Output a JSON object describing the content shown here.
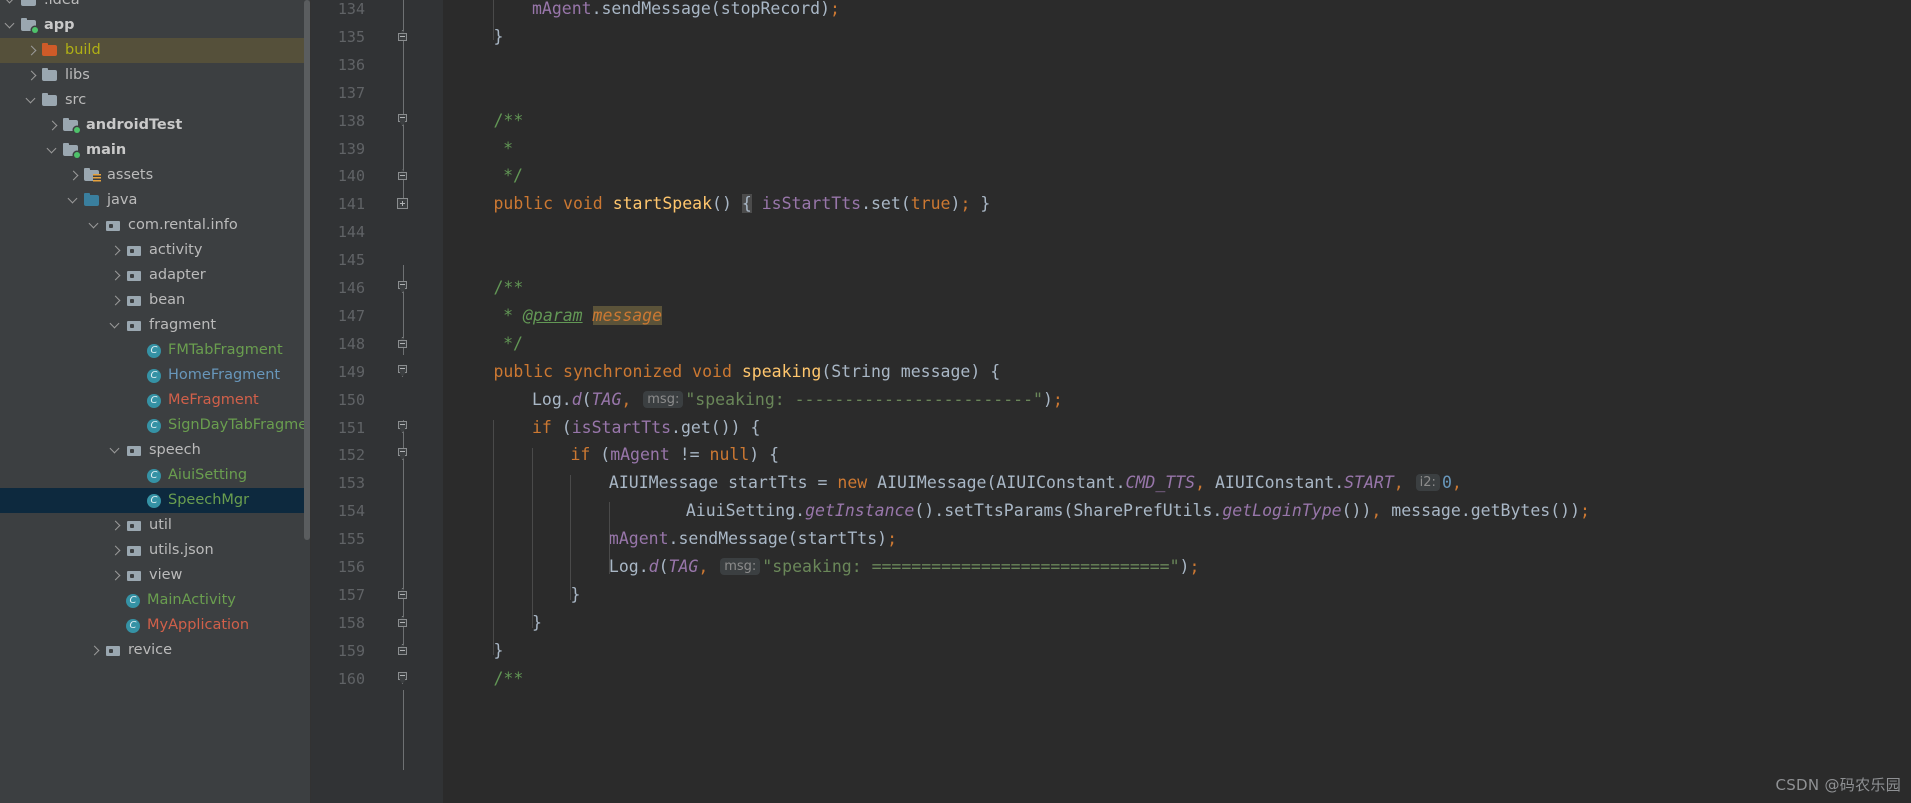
{
  "window": {
    "theme": "darcula",
    "colors": {
      "sidebar_bg": "#3c3f41",
      "editor_bg": "#2b2b2b",
      "gutter_bg": "#313335",
      "selection_bg": "#0d293e",
      "build_highlight_bg": "#55503a",
      "keyword": "#cc7832",
      "string": "#6a8759",
      "comment": "#629755",
      "number": "#6897bb",
      "field": "#9876aa",
      "method_decl": "#ffc66d",
      "default_text": "#a9b7c6",
      "line_number": "#606366"
    }
  },
  "project_tree": {
    "name": "Project",
    "items": [
      {
        "label": ".idea",
        "indent": 0,
        "twisty": "down",
        "icon": "folder-icon",
        "style": "plain",
        "selected": false
      },
      {
        "label": "app",
        "indent": 0,
        "twisty": "down",
        "icon": "module-folder-icon",
        "style": "bold",
        "selected": false
      },
      {
        "label": "build",
        "indent": 1,
        "twisty": "right",
        "icon": "folder-red-icon",
        "style": "build",
        "selected": false
      },
      {
        "label": "libs",
        "indent": 1,
        "twisty": "right",
        "icon": "folder-icon",
        "style": "plain",
        "selected": false
      },
      {
        "label": "src",
        "indent": 1,
        "twisty": "down",
        "icon": "folder-icon",
        "style": "plain",
        "selected": false
      },
      {
        "label": "androidTest",
        "indent": 2,
        "twisty": "right",
        "icon": "module-folder-icon",
        "style": "bold",
        "selected": false
      },
      {
        "label": "main",
        "indent": 2,
        "twisty": "down",
        "icon": "module-folder-icon",
        "style": "bold",
        "selected": false
      },
      {
        "label": "assets",
        "indent": 3,
        "twisty": "right",
        "icon": "assets-folder-icon",
        "style": "plain",
        "selected": false
      },
      {
        "label": "java",
        "indent": 3,
        "twisty": "down",
        "icon": "folder-blue-icon",
        "style": "plain",
        "selected": false
      },
      {
        "label": "com.rental.info",
        "indent": 4,
        "twisty": "down",
        "icon": "package-icon",
        "style": "plain",
        "selected": false
      },
      {
        "label": "activity",
        "indent": 5,
        "twisty": "right",
        "icon": "package-icon",
        "style": "plain",
        "selected": false
      },
      {
        "label": "adapter",
        "indent": 5,
        "twisty": "right",
        "icon": "package-icon",
        "style": "plain",
        "selected": false
      },
      {
        "label": "bean",
        "indent": 5,
        "twisty": "right",
        "icon": "package-icon",
        "style": "plain",
        "selected": false
      },
      {
        "label": "fragment",
        "indent": 5,
        "twisty": "down",
        "icon": "package-icon",
        "style": "plain",
        "selected": false
      },
      {
        "label": "FMTabFragment",
        "indent": 6,
        "twisty": "none",
        "icon": "java-class-icon",
        "style": "green",
        "selected": false
      },
      {
        "label": "HomeFragment",
        "indent": 6,
        "twisty": "none",
        "icon": "java-class-icon",
        "style": "blue",
        "selected": false
      },
      {
        "label": "MeFragment",
        "indent": 6,
        "twisty": "none",
        "icon": "java-class-icon",
        "style": "red",
        "selected": false
      },
      {
        "label": "SignDayTabFragment",
        "indent": 6,
        "twisty": "none",
        "icon": "java-class-icon",
        "style": "green",
        "selected": false
      },
      {
        "label": "speech",
        "indent": 5,
        "twisty": "down",
        "icon": "package-icon",
        "style": "plain",
        "selected": false
      },
      {
        "label": "AiuiSetting",
        "indent": 6,
        "twisty": "none",
        "icon": "java-class-icon",
        "style": "green",
        "selected": false
      },
      {
        "label": "SpeechMgr",
        "indent": 6,
        "twisty": "none",
        "icon": "java-class-icon",
        "style": "green",
        "selected": true
      },
      {
        "label": "util",
        "indent": 5,
        "twisty": "right",
        "icon": "package-icon",
        "style": "plain",
        "selected": false
      },
      {
        "label": "utils.json",
        "indent": 5,
        "twisty": "right",
        "icon": "package-icon",
        "style": "plain",
        "selected": false
      },
      {
        "label": "view",
        "indent": 5,
        "twisty": "right",
        "icon": "package-icon",
        "style": "plain",
        "selected": false
      },
      {
        "label": "MainActivity",
        "indent": 5,
        "twisty": "none",
        "icon": "java-class-icon",
        "style": "green",
        "selected": false
      },
      {
        "label": "MyApplication",
        "indent": 5,
        "twisty": "none",
        "icon": "java-class-icon",
        "style": "red",
        "selected": false
      },
      {
        "label": "revice",
        "indent": 4,
        "twisty": "right",
        "icon": "package-icon",
        "style": "plain",
        "selected": false
      }
    ]
  },
  "editor": {
    "first_visible_line": 134,
    "line_numbers": [
      134,
      135,
      136,
      137,
      138,
      139,
      140,
      141,
      144,
      145,
      146,
      147,
      148,
      149,
      150,
      151,
      152,
      153,
      154,
      155,
      156,
      157,
      158,
      159,
      160
    ],
    "folded_after_line": 141,
    "lines": [
      {
        "no": 134,
        "fold": "none",
        "text": "        mAgent.sendMessage(stopRecord);"
      },
      {
        "no": 135,
        "fold": "cap-up",
        "text": "    }"
      },
      {
        "no": 136,
        "fold": "none",
        "text": ""
      },
      {
        "no": 137,
        "fold": "none",
        "text": ""
      },
      {
        "no": 138,
        "fold": "cap-down",
        "text": "    /**"
      },
      {
        "no": 139,
        "fold": "none",
        "text": "     *"
      },
      {
        "no": 140,
        "fold": "cap-up",
        "text": "     */"
      },
      {
        "no": 141,
        "fold": "plus-box",
        "text": "    public void startSpeak() { isStartTts.set(true); }"
      },
      {
        "no": 144,
        "fold": "none",
        "text": ""
      },
      {
        "no": 145,
        "fold": "none",
        "text": ""
      },
      {
        "no": 146,
        "fold": "cap-down",
        "text": "    /**"
      },
      {
        "no": 147,
        "fold": "none",
        "text": "     * @param message"
      },
      {
        "no": 148,
        "fold": "cap-up",
        "text": "     */"
      },
      {
        "no": 149,
        "fold": "cap-down",
        "text": "    public synchronized void speaking(String message) {"
      },
      {
        "no": 150,
        "fold": "none",
        "text": "        Log.d(TAG,  msg: \"speaking: ------------------------\");"
      },
      {
        "no": 151,
        "fold": "cap-down",
        "text": "        if (isStartTts.get()) {"
      },
      {
        "no": 152,
        "fold": "cap-down",
        "text": "            if (mAgent != null) {"
      },
      {
        "no": 153,
        "fold": "none",
        "text": "                AIUIMessage startTts = new AIUIMessage(AIUIConstant.CMD_TTS, AIUIConstant.START,  i2: 0,"
      },
      {
        "no": 154,
        "fold": "none",
        "text": "                        AiuiSetting.getInstance().setTtsParams(SharePrefUtils.getLoginType()), message.getBytes());"
      },
      {
        "no": 155,
        "fold": "none",
        "text": "                mAgent.sendMessage(startTts);"
      },
      {
        "no": 156,
        "fold": "none",
        "text": "                Log.d(TAG,  msg: \"speaking: ==============================\");"
      },
      {
        "no": 157,
        "fold": "cap-up",
        "text": "            }"
      },
      {
        "no": 158,
        "fold": "cap-up",
        "text": "        }"
      },
      {
        "no": 159,
        "fold": "cap-up",
        "text": "    }"
      },
      {
        "no": 160,
        "fold": "cap-down",
        "text": "    /**"
      }
    ],
    "inlay_hints": [
      {
        "line": 150,
        "label": "msg:"
      },
      {
        "line": 153,
        "label": "i2:"
      },
      {
        "line": 156,
        "label": "msg:"
      }
    ]
  },
  "watermark": {
    "text": "CSDN @码农乐园"
  }
}
